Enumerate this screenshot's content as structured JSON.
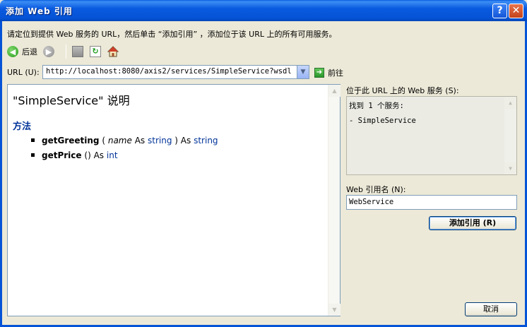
{
  "window": {
    "title": "添加 Web 引用"
  },
  "instruction": "请定位到提供 Web 服务的 URL，然后单击 “添加引用” ，添加位于该 URL 上的所有可用服务。",
  "toolbar": {
    "back_label": "后退"
  },
  "url": {
    "label": "URL (U):",
    "value": "http://localhost:8080/axis2/services/SimpleService?wsdl",
    "go_label": "前往"
  },
  "browser": {
    "service_title": "\"SimpleService\" 说明",
    "methods_heading": "方法",
    "methods": [
      {
        "name": "getGreeting",
        "open": "(",
        "param": "name",
        "as1": "As",
        "type1": "string",
        "close": ")",
        "as2": "As",
        "ret": "string"
      },
      {
        "name": "getPrice",
        "open": "(",
        "param": "",
        "as1": "",
        "type1": "",
        "close": ")",
        "as2": "As",
        "ret": "int"
      }
    ]
  },
  "services": {
    "label": "位于此 URL 上的 Web 服务 (S):",
    "found": "找到 1 个服务:",
    "items": [
      "- SimpleService"
    ]
  },
  "reference": {
    "label": "Web 引用名 (N):",
    "value": "WebService",
    "add_label": "添加引用 (R)"
  },
  "cancel_label": "取消"
}
